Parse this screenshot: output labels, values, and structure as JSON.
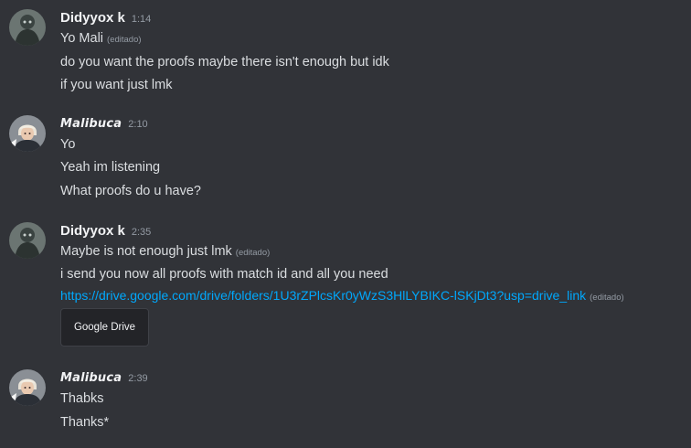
{
  "colors": {
    "background": "#313338",
    "text": "#dbdee1",
    "username": "#f2f3f5",
    "muted": "#949ba4",
    "link": "#00a8fc"
  },
  "messages": [
    {
      "author": "Didyyox k",
      "time": "1:14",
      "avatar_icon": "gray-character-avatar-icon",
      "lines": [
        {
          "text": "Yo Mali",
          "edited": "(editado)"
        },
        {
          "text": "do you want the proofs maybe there isn't enough but idk"
        },
        {
          "text": "if you want just lmk"
        }
      ]
    },
    {
      "author": "Malibuca",
      "time": "2:10",
      "avatar_icon": "anime-character-avatar-icon",
      "lines": [
        {
          "text": "Yo"
        },
        {
          "text": "Yeah im listening"
        },
        {
          "text": "What proofs do u have?"
        }
      ]
    },
    {
      "author": "Didyyox k",
      "time": "2:35",
      "avatar_icon": "gray-character-avatar-icon",
      "lines": [
        {
          "text": "Maybe is not enough just lmk",
          "edited": "(editado)"
        },
        {
          "text": "i send you now all proofs with match id and all you need"
        },
        {
          "link": "https://drive.google.com/drive/folders/1U3rZPlcsKr0yWzS3HlLYBIKC-lSKjDt3?usp=drive_link",
          "edited": "(editado)"
        }
      ],
      "embed_button": "Google Drive"
    },
    {
      "author": "Malibuca",
      "time": "2:39",
      "avatar_icon": "anime-character-avatar-icon",
      "lines": [
        {
          "text": "Thabks"
        },
        {
          "text": "Thanks*"
        }
      ]
    }
  ]
}
